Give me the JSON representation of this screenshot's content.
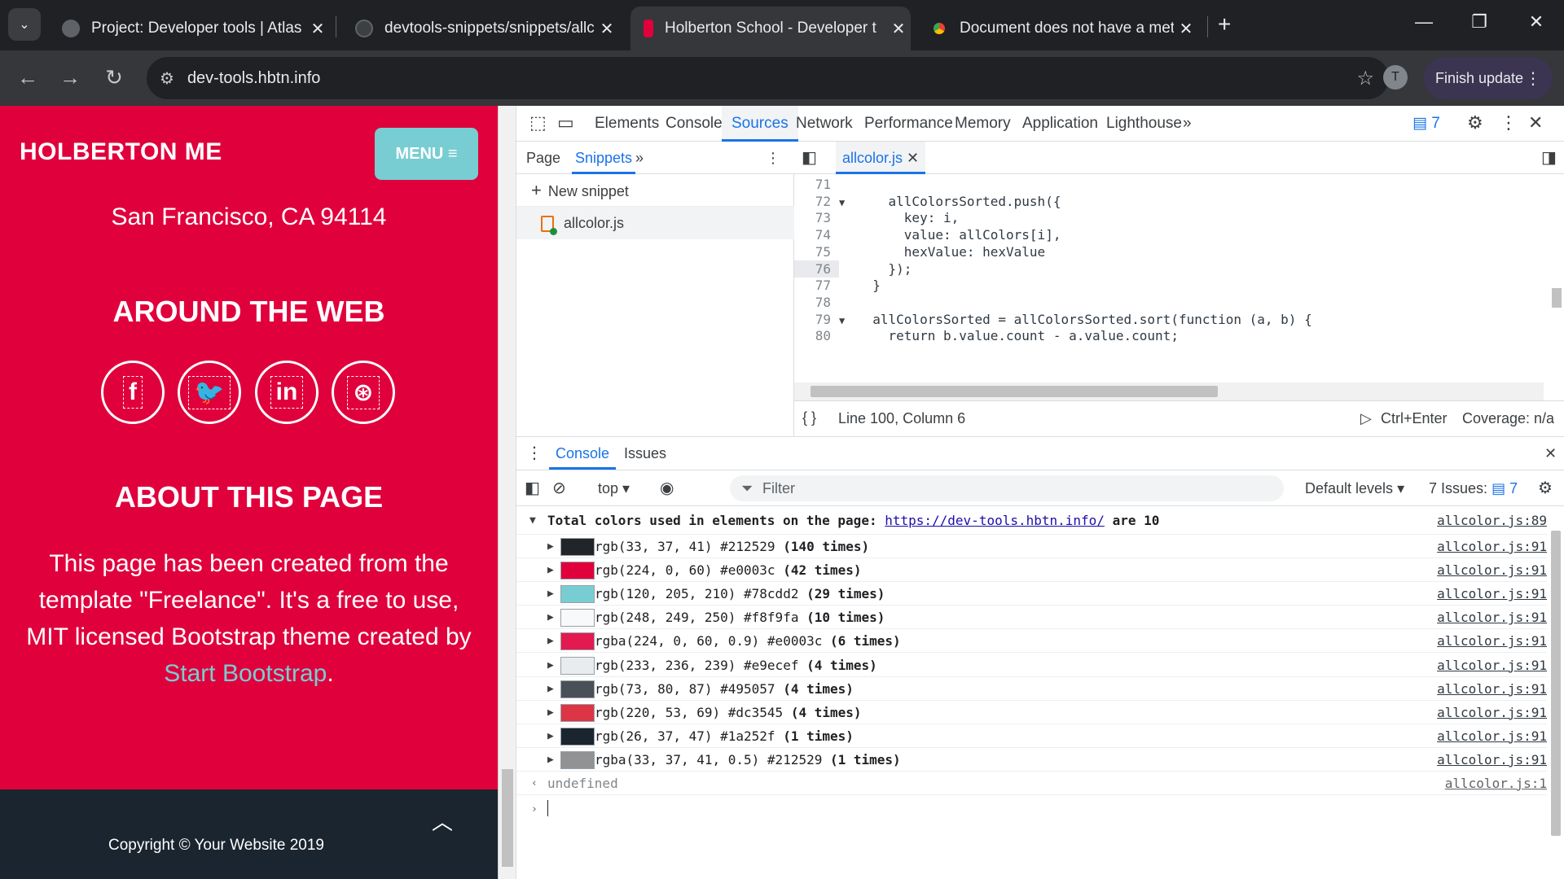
{
  "browser": {
    "tabs": [
      {
        "title": "Project: Developer tools | Atlas"
      },
      {
        "title": "devtools-snippets/snippets/allc"
      },
      {
        "title": "Holberton School - Developer t"
      },
      {
        "title": "Document does not have a met"
      }
    ],
    "url": "dev-tools.hbtn.info",
    "profile_initial": "T",
    "finish_update": "Finish update"
  },
  "page": {
    "brand": "HOLBERTON ME",
    "menu": "MENU",
    "address": "San Francisco, CA 94114",
    "around_web": "AROUND THE WEB",
    "social": [
      "f",
      "t",
      "in",
      "dribbble"
    ],
    "about_title": "ABOUT THIS PAGE",
    "about_text_1": "This page has been created from the template \"Freelance\". It's a free to use, MIT licensed Bootstrap theme created by ",
    "about_link": "Start Bootstrap",
    "about_text_2": ".",
    "copyright": "Copyright © Your Website 2019"
  },
  "devtools": {
    "tabs": [
      "Elements",
      "Console",
      "Sources",
      "Network",
      "Performance",
      "Memory",
      "Application",
      "Lighthouse"
    ],
    "active_tab": "Sources",
    "issues_badge": "7",
    "nav_tabs": [
      "Page",
      "Snippets"
    ],
    "new_snippet": "New snippet",
    "snippet_file": "allcolor.js",
    "editor_file": "allcolor.js",
    "code": [
      {
        "n": "71",
        "arrow": "",
        "text": ""
      },
      {
        "n": "72",
        "arrow": "▼",
        "text": "    allColorsSorted.push({"
      },
      {
        "n": "73",
        "arrow": "",
        "text": "      key: i,"
      },
      {
        "n": "74",
        "arrow": "",
        "text": "      value: allColors[i],"
      },
      {
        "n": "75",
        "arrow": "",
        "text": "      hexValue: hexValue"
      },
      {
        "n": "76",
        "arrow": "",
        "text": "    });"
      },
      {
        "n": "77",
        "arrow": "",
        "text": "  }"
      },
      {
        "n": "78",
        "arrow": "",
        "text": ""
      },
      {
        "n": "79",
        "arrow": "▼",
        "text": "  allColorsSorted = allColorsSorted.sort(function (a, b) {"
      },
      {
        "n": "80",
        "arrow": "",
        "text": "    return b.value.count - a.value.count;"
      }
    ],
    "status_position": "Line 100, Column 6",
    "run_hint": "Ctrl+Enter",
    "coverage": "Coverage: n/a",
    "drawer_tabs": [
      "Console",
      "Issues"
    ],
    "context": "top",
    "filter_placeholder": "Filter",
    "levels": "Default levels",
    "issues_count": "7 Issues:",
    "issues_count_badge": "7",
    "header_prefix": "Total colors used in elements on the page: ",
    "header_url": "https://dev-tools.hbtn.info/",
    "header_suffix": " are 10",
    "header_src": "allcolor.js:89",
    "rows": [
      {
        "color": "#212529",
        "text": "rgb(33, 37, 41) #212529 ",
        "count": "(140 times)",
        "src": "allcolor.js:91"
      },
      {
        "color": "#e0003c",
        "text": "rgb(224, 0, 60) #e0003c ",
        "count": "(42 times)",
        "src": "allcolor.js:91"
      },
      {
        "color": "#78cdd2",
        "text": "rgb(120, 205, 210) #78cdd2 ",
        "count": "(29 times)",
        "src": "allcolor.js:91"
      },
      {
        "color": "#f8f9fa",
        "text": "rgb(248, 249, 250) #f8f9fa ",
        "count": "(10 times)",
        "src": "allcolor.js:91"
      },
      {
        "color": "#e31a50",
        "text": "rgba(224, 0, 60, 0.9) #e0003c ",
        "count": "(6 times)",
        "src": "allcolor.js:91"
      },
      {
        "color": "#e9ecef",
        "text": "rgb(233, 236, 239) #e9ecef ",
        "count": "(4 times)",
        "src": "allcolor.js:91"
      },
      {
        "color": "#495057",
        "text": "rgb(73, 80, 87) #495057 ",
        "count": "(4 times)",
        "src": "allcolor.js:91"
      },
      {
        "color": "#dc3545",
        "text": "rgb(220, 53, 69) #dc3545 ",
        "count": "(4 times)",
        "src": "allcolor.js:91"
      },
      {
        "color": "#1a252f",
        "text": "rgb(26, 37, 47) #1a252f ",
        "count": "(1 times)",
        "src": "allcolor.js:91"
      },
      {
        "color": "#909294",
        "text": "rgba(33, 37, 41, 0.5) #212529 ",
        "count": "(1 times)",
        "src": "allcolor.js:91"
      }
    ],
    "result": "undefined",
    "result_src": "allcolor.js:1"
  }
}
